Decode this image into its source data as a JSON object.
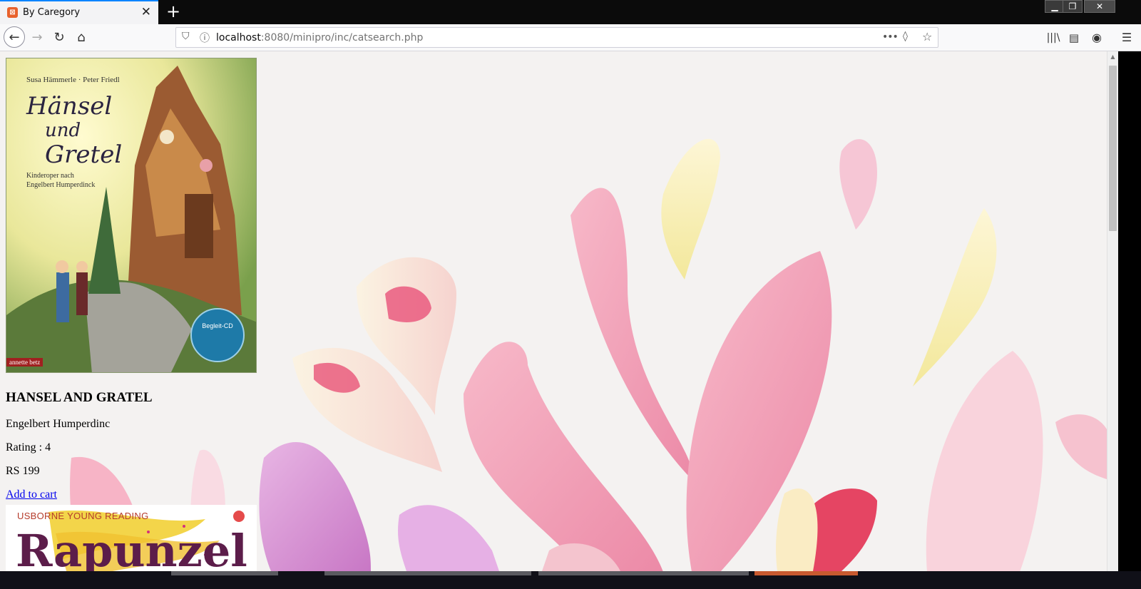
{
  "browser": {
    "tab_title": "By Caregory",
    "tab_close": "✕",
    "new_tab": "+",
    "window_controls": {
      "minimize": "▁",
      "restore": "❐",
      "close": "✕"
    },
    "nav": {
      "back": "←",
      "forward": "→",
      "reload": "↻",
      "home": "⌂"
    },
    "url_host": "localhost",
    "url_rest": ":8080/minipro/inc/catsearch.php",
    "url_actions": {
      "more": "•••",
      "pocket": "◊",
      "bookmark": "☆"
    },
    "toolbar_icons": {
      "library": "|||\\",
      "sidebar": "▤",
      "account": "◉",
      "menu": "☰"
    }
  },
  "books": [
    {
      "cover": {
        "authors": "Susa Hämmerle · Peter Friedl",
        "title_line1": "Hänsel",
        "title_line2": "und",
        "title_line3": "Gretel",
        "subtitle_line1": "Kinderoper nach",
        "subtitle_line2": "Engelbert Humperdinck",
        "badge": "Begleit-CD",
        "publisher": "annette betz"
      },
      "title": "HANSEL AND GRATEL",
      "author": "Engelbert Humperdinc",
      "rating": "Rating : 4",
      "price": "RS 199",
      "add_to_cart": "Add to cart"
    },
    {
      "cover": {
        "series": "USBORNE YOUNG READING",
        "title": "Rapunzel"
      }
    }
  ],
  "colors": {
    "link": "#0000ee",
    "accent_tab": "#0a84ff",
    "background_petals": "#f2a7bd"
  }
}
